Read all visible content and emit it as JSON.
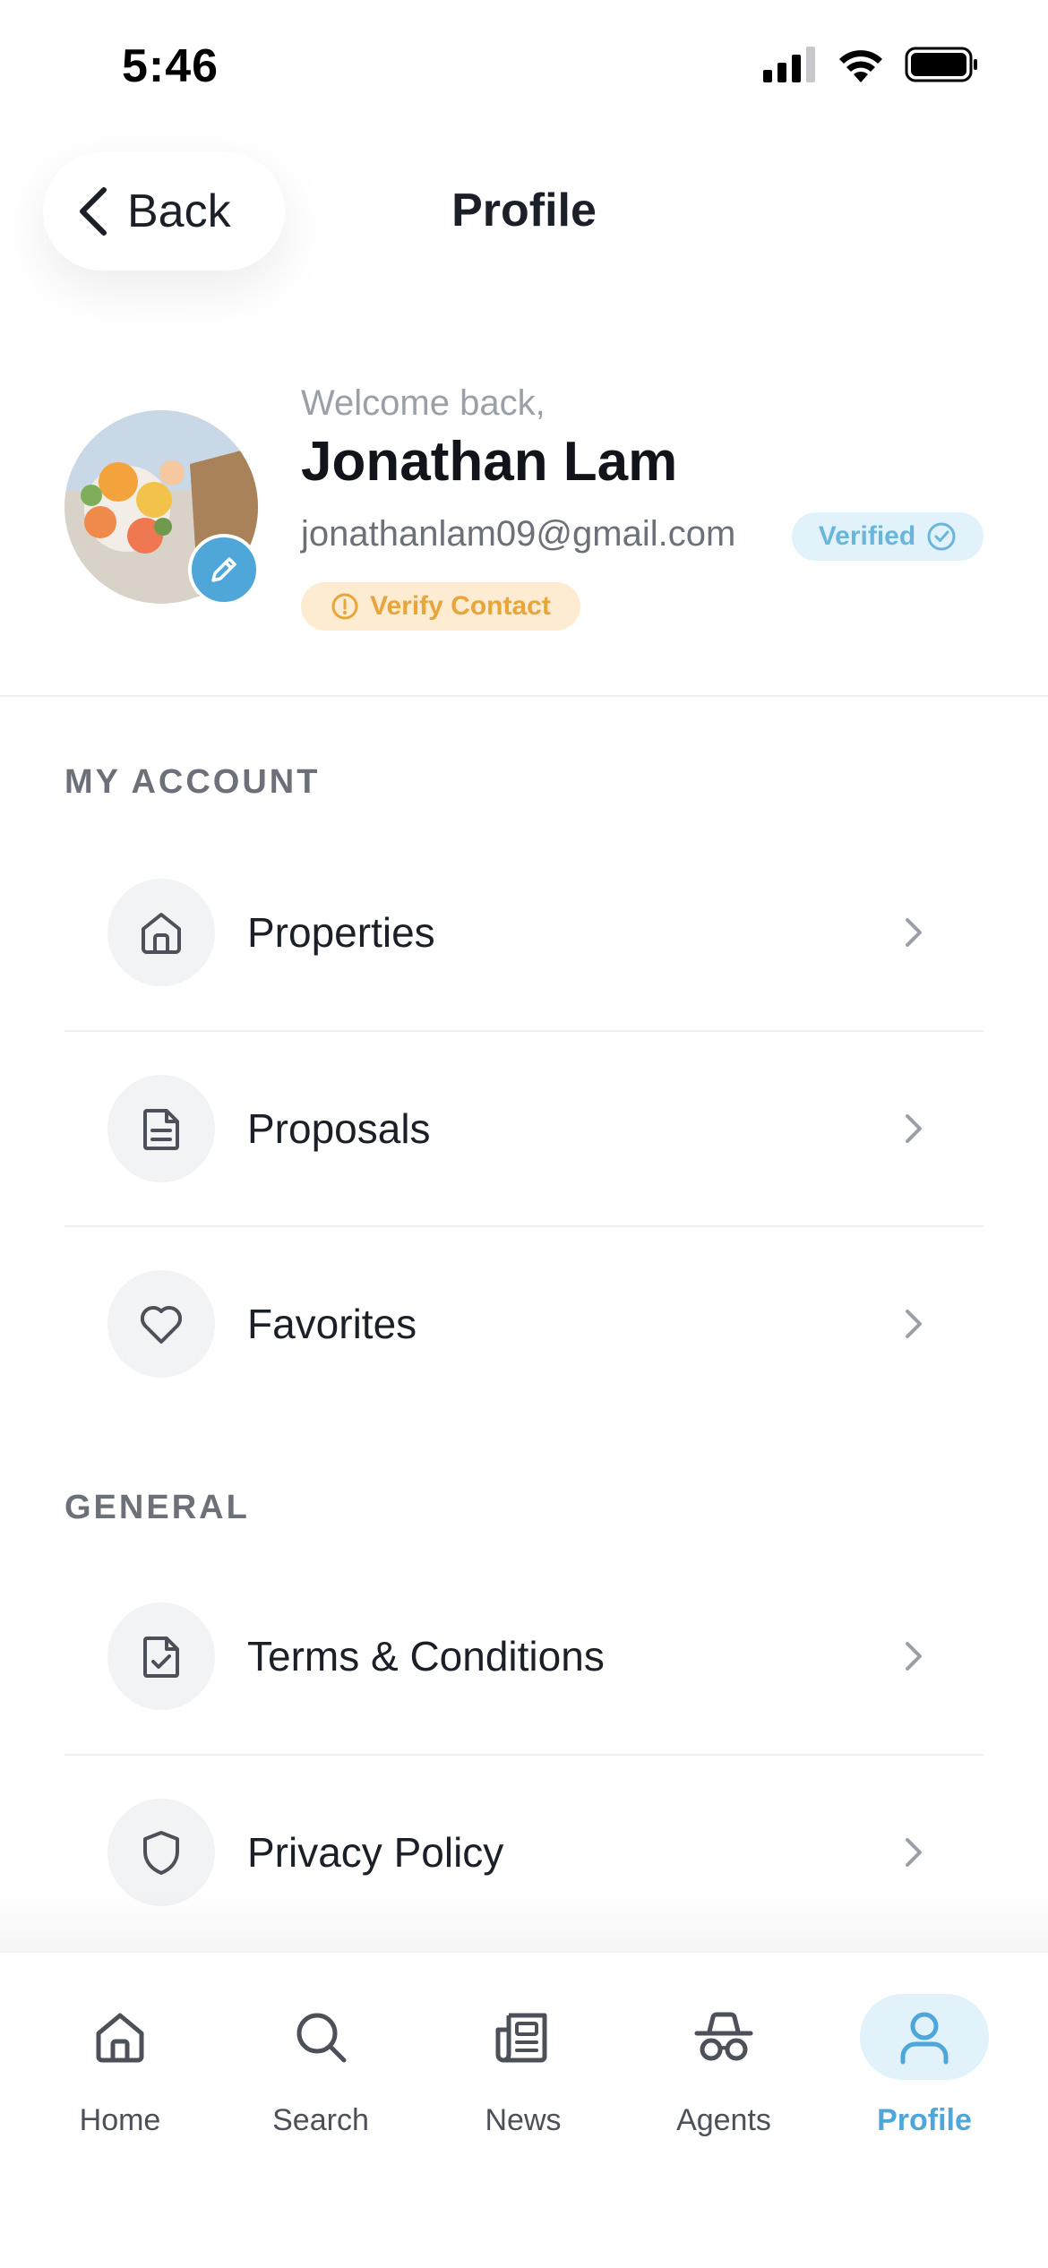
{
  "status_bar": {
    "time": "5:46"
  },
  "header": {
    "back_label": "Back",
    "title": "Profile"
  },
  "profile": {
    "welcome": "Welcome back,",
    "name": "Jonathan Lam",
    "email": "jonathanlam09@gmail.com",
    "verified_label": "Verified",
    "verify_contact_label": "Verify Contact"
  },
  "sections": {
    "my_account": {
      "title": "MY ACCOUNT",
      "items": [
        {
          "label": "Properties",
          "icon": "home-icon"
        },
        {
          "label": "Proposals",
          "icon": "document-icon"
        },
        {
          "label": "Favorites",
          "icon": "heart-icon"
        }
      ]
    },
    "general": {
      "title": "GENERAL",
      "items": [
        {
          "label": "Terms & Conditions",
          "icon": "file-check-icon"
        },
        {
          "label": "Privacy Policy",
          "icon": "shield-icon"
        }
      ]
    }
  },
  "bottom_nav": {
    "items": [
      {
        "label": "Home",
        "icon": "home-icon"
      },
      {
        "label": "Search",
        "icon": "search-icon"
      },
      {
        "label": "News",
        "icon": "newspaper-icon"
      },
      {
        "label": "Agents",
        "icon": "agent-icon"
      },
      {
        "label": "Profile",
        "icon": "user-icon",
        "active": true
      }
    ]
  },
  "colors": {
    "accent": "#4fa6d9",
    "accent_bg": "#e1f2fa",
    "warning": "#e7a53a",
    "warning_bg": "#fdecd1",
    "text": "#1b1f27",
    "muted": "#6b7079"
  }
}
